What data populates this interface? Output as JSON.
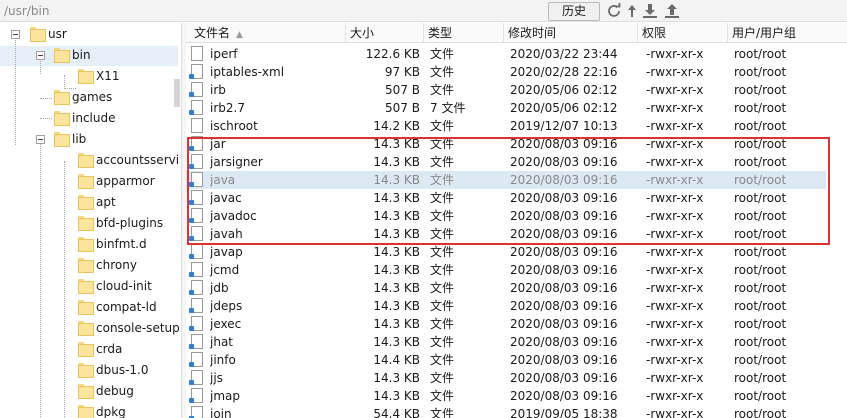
{
  "toolbar": {
    "path": "/usr/bin",
    "history_label": "历史"
  },
  "tree": {
    "items": [
      {
        "label": "usr"
      },
      {
        "label": "bin"
      },
      {
        "label": "X11"
      },
      {
        "label": "games"
      },
      {
        "label": "include"
      },
      {
        "label": "lib"
      },
      {
        "label": "accountsservi"
      },
      {
        "label": "apparmor"
      },
      {
        "label": "apt"
      },
      {
        "label": "bfd-plugins"
      },
      {
        "label": "binfmt.d"
      },
      {
        "label": "chrony"
      },
      {
        "label": "cloud-init"
      },
      {
        "label": "compat-ld"
      },
      {
        "label": "console-setup"
      },
      {
        "label": "crda"
      },
      {
        "label": "dbus-1.0"
      },
      {
        "label": "debug"
      },
      {
        "label": "dpkg"
      }
    ]
  },
  "columns": {
    "name": "文件名",
    "size": "大小",
    "type": "类型",
    "modified": "修改时间",
    "perm": "权限",
    "owner": "用户/用户组"
  },
  "files": [
    {
      "name": "iperf",
      "size": "122.6 KB",
      "type": "文件",
      "modified": "2020/03/22 23:44",
      "perm": "-rwxr-xr-x",
      "owner": "root/root"
    },
    {
      "name": "iptables-xml",
      "size": "97 KB",
      "type": "文件",
      "modified": "2020/02/28 22:16",
      "perm": "-rwxr-xr-x",
      "owner": "root/root"
    },
    {
      "name": "irb",
      "size": "507 B",
      "type": "文件",
      "modified": "2020/05/06 02:12",
      "perm": "-rwxr-xr-x",
      "owner": "root/root"
    },
    {
      "name": "irb2.7",
      "size": "507 B",
      "type": "7 文件",
      "modified": "2020/05/06 02:12",
      "perm": "-rwxr-xr-x",
      "owner": "root/root"
    },
    {
      "name": "ischroot",
      "size": "14.2 KB",
      "type": "文件",
      "modified": "2019/12/07 10:13",
      "perm": "-rwxr-xr-x",
      "owner": "root/root"
    },
    {
      "name": "jar",
      "size": "14.3 KB",
      "type": "文件",
      "modified": "2020/08/03 09:16",
      "perm": "-rwxr-xr-x",
      "owner": "root/root"
    },
    {
      "name": "jarsigner",
      "size": "14.3 KB",
      "type": "文件",
      "modified": "2020/08/03 09:16",
      "perm": "-rwxr-xr-x",
      "owner": "root/root"
    },
    {
      "name": "java",
      "size": "14.3 KB",
      "type": "文件",
      "modified": "2020/08/03 09:16",
      "perm": "-rwxr-xr-x",
      "owner": "root/root"
    },
    {
      "name": "javac",
      "size": "14.3 KB",
      "type": "文件",
      "modified": "2020/08/03 09:16",
      "perm": "-rwxr-xr-x",
      "owner": "root/root"
    },
    {
      "name": "javadoc",
      "size": "14.3 KB",
      "type": "文件",
      "modified": "2020/08/03 09:16",
      "perm": "-rwxr-xr-x",
      "owner": "root/root"
    },
    {
      "name": "javah",
      "size": "14.3 KB",
      "type": "文件",
      "modified": "2020/08/03 09:16",
      "perm": "-rwxr-xr-x",
      "owner": "root/root"
    },
    {
      "name": "javap",
      "size": "14.3 KB",
      "type": "文件",
      "modified": "2020/08/03 09:16",
      "perm": "-rwxr-xr-x",
      "owner": "root/root"
    },
    {
      "name": "jcmd",
      "size": "14.3 KB",
      "type": "文件",
      "modified": "2020/08/03 09:16",
      "perm": "-rwxr-xr-x",
      "owner": "root/root"
    },
    {
      "name": "jdb",
      "size": "14.3 KB",
      "type": "文件",
      "modified": "2020/08/03 09:16",
      "perm": "-rwxr-xr-x",
      "owner": "root/root"
    },
    {
      "name": "jdeps",
      "size": "14.3 KB",
      "type": "文件",
      "modified": "2020/08/03 09:16",
      "perm": "-rwxr-xr-x",
      "owner": "root/root"
    },
    {
      "name": "jexec",
      "size": "14.3 KB",
      "type": "文件",
      "modified": "2020/08/03 09:16",
      "perm": "-rwxr-xr-x",
      "owner": "root/root"
    },
    {
      "name": "jhat",
      "size": "14.3 KB",
      "type": "文件",
      "modified": "2020/08/03 09:16",
      "perm": "-rwxr-xr-x",
      "owner": "root/root"
    },
    {
      "name": "jinfo",
      "size": "14.4 KB",
      "type": "文件",
      "modified": "2020/08/03 09:16",
      "perm": "-rwxr-xr-x",
      "owner": "root/root"
    },
    {
      "name": "jjs",
      "size": "14.3 KB",
      "type": "文件",
      "modified": "2020/08/03 09:16",
      "perm": "-rwxr-xr-x",
      "owner": "root/root"
    },
    {
      "name": "jmap",
      "size": "14.3 KB",
      "type": "文件",
      "modified": "2020/08/03 09:16",
      "perm": "-rwxr-xr-x",
      "owner": "root/root"
    },
    {
      "name": "join",
      "size": "54.4 KB",
      "type": "文件",
      "modified": "2019/09/05 18:38",
      "perm": "-rwxr-xr-x",
      "owner": "root/root"
    }
  ],
  "colors": {
    "highlight": "#e0302f",
    "selection": "#dce8f3",
    "accent": "#2f7fd8"
  }
}
